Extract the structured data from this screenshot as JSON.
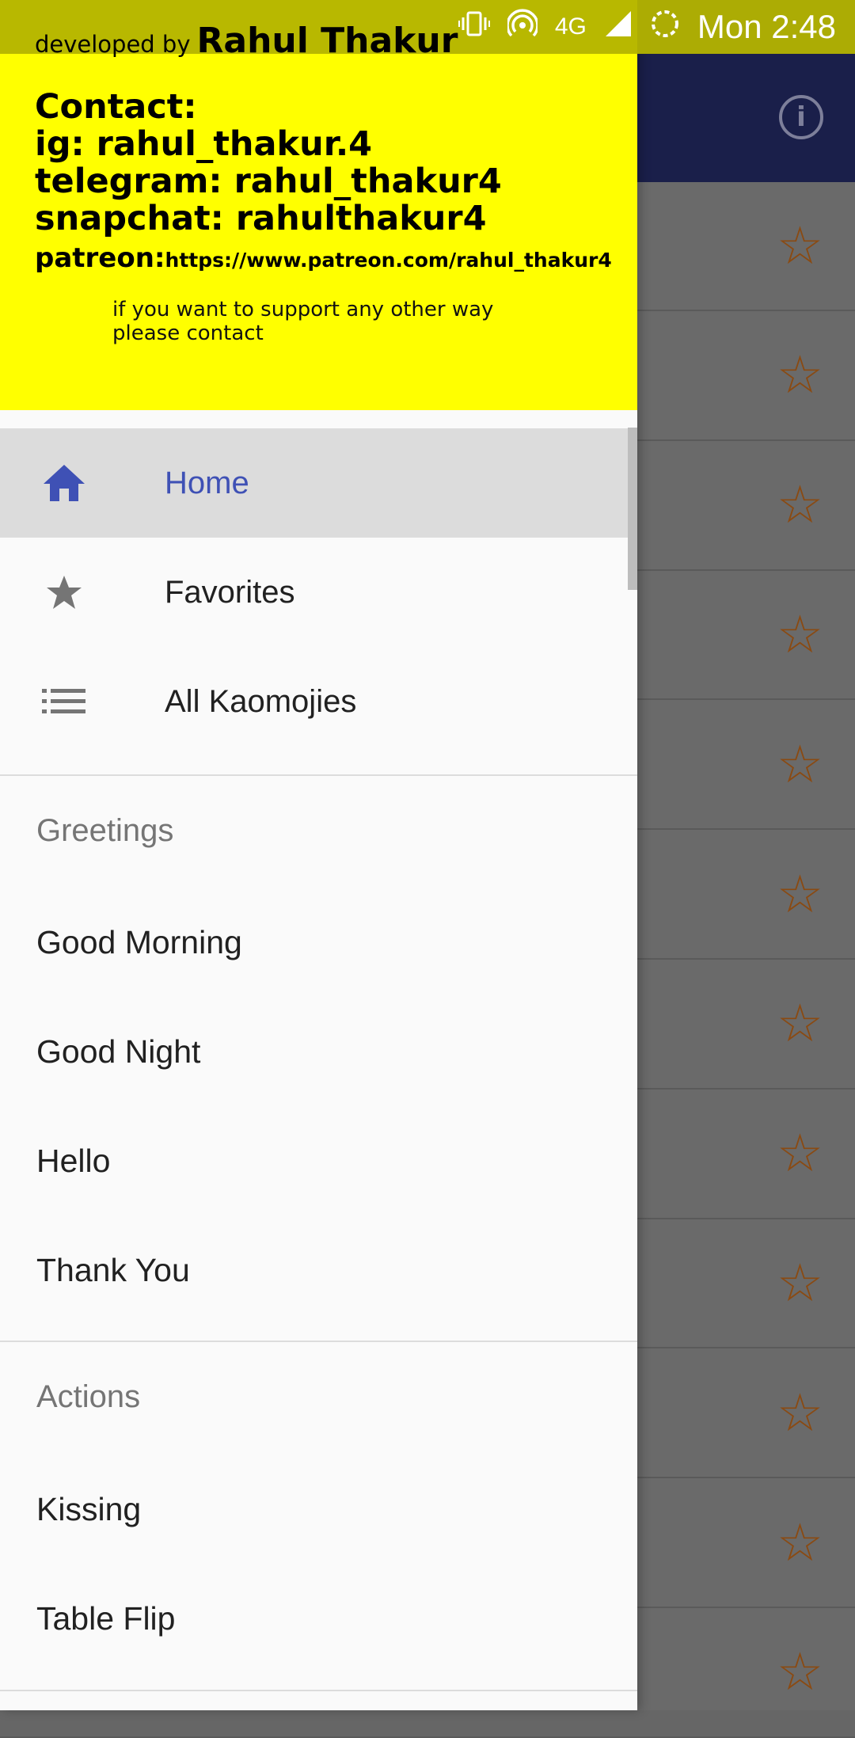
{
  "status_bar": {
    "network": "4G",
    "time": "Mon 2:48",
    "icons": [
      "vibrate-icon",
      "hotspot-icon",
      "signal-icon",
      "loading-icon"
    ]
  },
  "header": {
    "developed_by_prefix": "developed by",
    "developer_name": "Rahul Thakur",
    "contact_title": "Contact:",
    "ig": "ig: rahul_thakur.4",
    "telegram": "telegram: rahul_thakur4",
    "snapchat": "snapchat: rahulthakur4",
    "patreon_label": "patreon:",
    "patreon_url": "https://www.patreon.com/rahul_thakur4",
    "support_note": "if you want to support any other way please contact",
    "background_color": "#ffff00"
  },
  "nav": {
    "items": [
      {
        "label": "Home",
        "icon": "home-icon",
        "active": true
      },
      {
        "label": "Favorites",
        "icon": "star-icon",
        "active": false
      },
      {
        "label": "All Kaomojies",
        "icon": "list-icon",
        "active": false
      }
    ],
    "accent_color": "#3f51b5"
  },
  "sections": [
    {
      "title": "Greetings",
      "items": [
        "Good Morning",
        "Good Night",
        "Hello",
        "Thank You"
      ]
    },
    {
      "title": "Actions",
      "items": [
        "Kissing",
        "Table Flip"
      ]
    }
  ],
  "background_app": {
    "toolbar_color": "#1a1f4a",
    "toolbar_icon": "info-icon",
    "row_icon": "star-outline-icon",
    "row_count": 12
  }
}
